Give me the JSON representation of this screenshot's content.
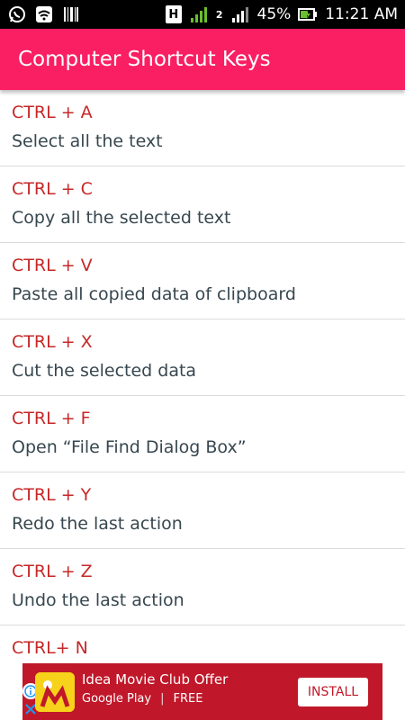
{
  "status_bar": {
    "battery": "45%",
    "time": "11:21 AM",
    "network_type": "H",
    "sim_number": "2"
  },
  "header": {
    "title": "Computer Shortcut Keys"
  },
  "shortcuts": [
    {
      "keys": "CTRL + A",
      "description": "Select all the text"
    },
    {
      "keys": "CTRL + C",
      "description": "Copy all the selected text"
    },
    {
      "keys": "CTRL + V",
      "description": "Paste all copied data of clipboard"
    },
    {
      "keys": "CTRL + X",
      "description": "Cut the selected data"
    },
    {
      "keys": "CTRL + F",
      "description": "Open “File Find Dialog Box”"
    },
    {
      "keys": "CTRL + Y",
      "description": "Redo the last action"
    },
    {
      "keys": "CTRL + Z",
      "description": "Undo the last action"
    },
    {
      "keys": "CTRL+ N",
      "description": ""
    }
  ],
  "ad": {
    "title": "Idea Movie Club Offer",
    "store": "Google Play",
    "price": "FREE",
    "button": "INSTALL"
  },
  "colors": {
    "accent": "#fa1f63",
    "shortcut_text": "#c62828",
    "ad_background": "#c0182a"
  }
}
